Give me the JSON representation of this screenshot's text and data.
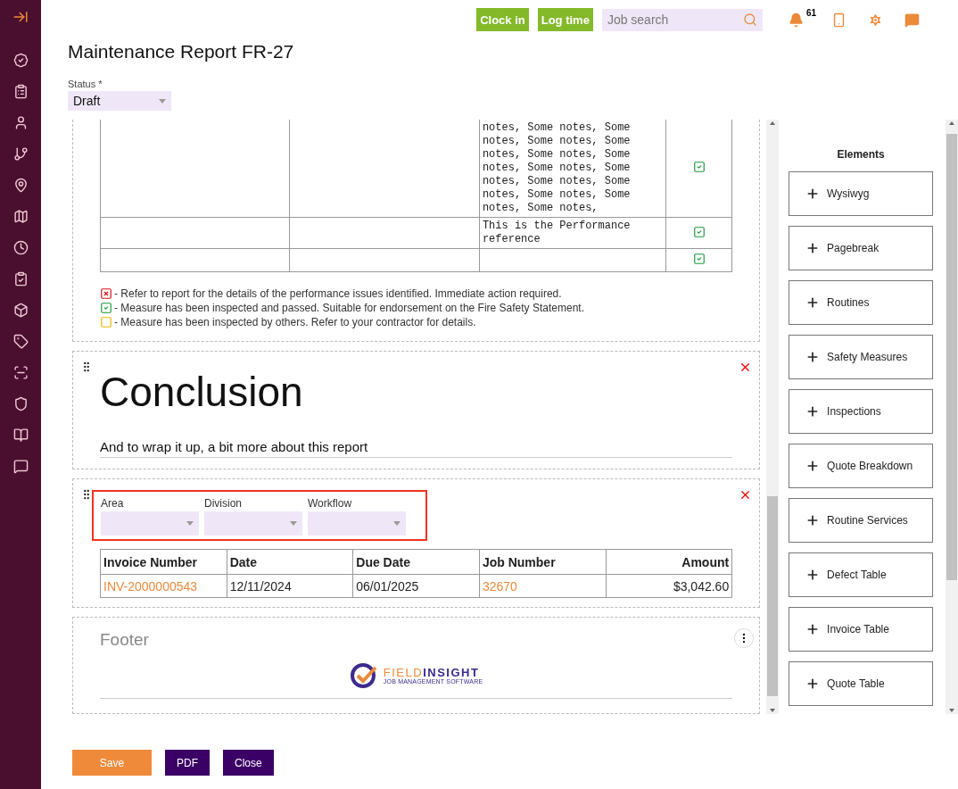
{
  "topbar": {
    "buttons": [
      "Clock in",
      "Log time"
    ],
    "search": {
      "placeholder": "Job search"
    },
    "notifications": {
      "count": "61"
    }
  },
  "page": {
    "title": "Maintenance Report FR-27",
    "status": {
      "label": "Status *",
      "value": "Draft"
    }
  },
  "editor": {
    "measures_table": {
      "rows": [
        {
          "column_3": "notes, Some notes, Some notes, Some notes, Some notes, Some notes, Some notes, Some notes, Some notes, Some notes, Some notes, Some notes, Some notes, Some notes,",
          "checked": true
        },
        {
          "column_3": "This is the Performance reference",
          "checked": true
        },
        {
          "checked": true
        }
      ]
    },
    "legend": [
      {
        "kind": "cross",
        "text": "- Refer to report for the details of the performance issues identified. Immediate action required."
      },
      {
        "kind": "check",
        "text": "- Measure has been inspected and passed. Suitable for endorsement on the Fire Safety Statement."
      },
      {
        "kind": "empty",
        "text": "- Measure has been inspected by others. Refer to your contractor for details."
      }
    ],
    "conclusion": {
      "heading": "Conclusion",
      "subheading": "And to wrap it up, a bit more about this report"
    },
    "invoice_block": {
      "highlighted": true,
      "filters": [
        {
          "label": "Area"
        },
        {
          "label": "Division"
        },
        {
          "label": "Workflow"
        }
      ],
      "columns": [
        {
          "label": "Invoice Number",
          "kind": "link"
        },
        {
          "label": "Date",
          "kind": "text"
        },
        {
          "label": "Due Date",
          "kind": "text"
        },
        {
          "label": "Job Number",
          "kind": "link"
        },
        {
          "label": "Amount",
          "kind": "amount"
        }
      ],
      "rows": [
        [
          "INV-2000000543",
          "12/11/2024",
          "06/01/2025",
          "32670",
          "$3,042.60"
        ]
      ]
    },
    "footer": {
      "title": "Footer",
      "logo": {
        "name_first": "FIELD",
        "name_second": "INSIGHT",
        "tagline": "JOB MANAGEMENT SOFTWARE"
      }
    }
  },
  "elements_panel": {
    "title": "Elements",
    "items": [
      "Wysiwyg",
      "Pagebreak",
      "Routines",
      "Safety Measures",
      "Inspections",
      "Quote Breakdown",
      "Routine Services",
      "Defect Table",
      "Invoice Table",
      "Quote Table"
    ]
  },
  "actions": [
    {
      "label": "Save",
      "kind": "primary"
    },
    {
      "label": "PDF",
      "kind": "secondary"
    },
    {
      "label": "Close",
      "kind": "secondary"
    }
  ]
}
